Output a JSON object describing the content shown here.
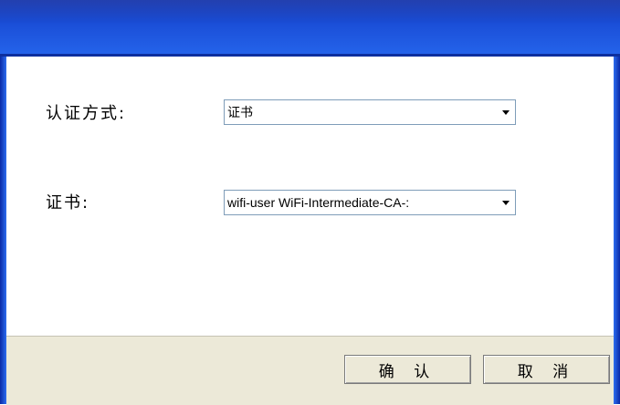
{
  "form": {
    "auth_method_label": "认证方式:",
    "auth_method_value": "证书",
    "certificate_label": "证书:",
    "certificate_value": "wifi-user  WiFi-Intermediate-CA-:"
  },
  "buttons": {
    "ok_label": "确 认",
    "cancel_label": "取 消"
  },
  "colors": {
    "titlebar": "#1b4fd8",
    "footer": "#ece9d8",
    "select_border": "#7f9db9"
  },
  "icons": {
    "dropdown": "chevron-down-icon"
  }
}
